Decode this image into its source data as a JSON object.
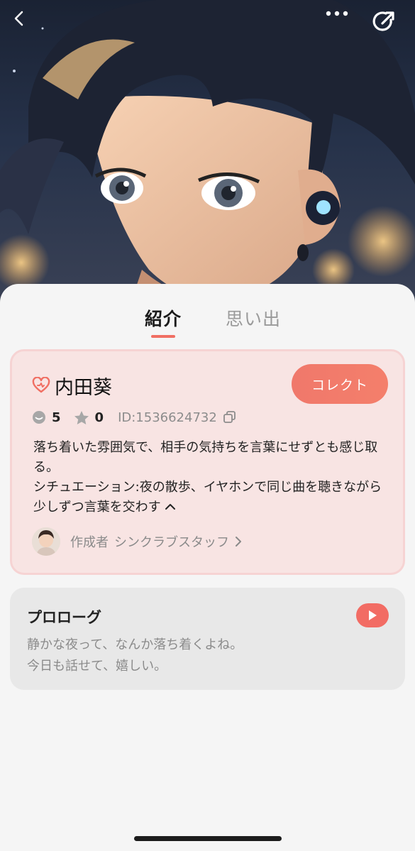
{
  "tabs": [
    {
      "label": "紹介"
    },
    {
      "label": "思い出"
    }
  ],
  "character": {
    "name": "内田葵",
    "collect_label": "コレクト",
    "chat_count": "5",
    "star_count": "0",
    "id_text": "ID:1536624732",
    "description_lines": [
      "落ち着いた雰囲気で、相手の気持ちを言葉にせずとも感じ取る。",
      "シチュエーション:夜の散歩、イヤホンで同じ曲を聴きながら少しずつ言葉を交わす"
    ],
    "creator_label": "作成者",
    "creator_name": "シンクラブスタッフ"
  },
  "prologue": {
    "title": "プロローグ",
    "lines": [
      "静かな夜って、なんか落ち着くよね。",
      "今日も話せて、嬉しい。"
    ]
  },
  "icons": {
    "back": "chevron-left-icon",
    "more": "more-dots-icon",
    "share": "share-icon",
    "heart": "heart-link-icon",
    "chat": "chat-bubble-icon",
    "star": "star-icon",
    "copy": "copy-icon",
    "expand": "chevron-up-icon",
    "play": "play-icon"
  },
  "colors": {
    "accent": "#f06f63",
    "card_bg": "#f8e4e3",
    "prologue_bg": "#e8e8e8"
  }
}
